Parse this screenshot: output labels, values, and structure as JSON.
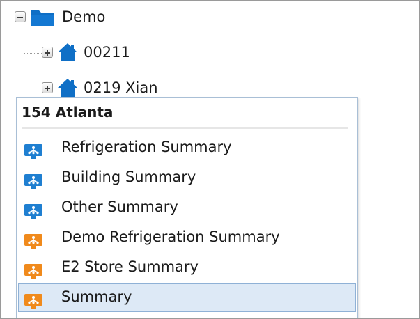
{
  "tree": {
    "root": {
      "label": "Demo",
      "icon": "folder-icon",
      "expander": "minus"
    },
    "children": [
      {
        "label": "00211",
        "icon": "house-icon",
        "expander": "plus"
      },
      {
        "label": "0219 Xian",
        "icon": "house-icon",
        "expander": "plus"
      }
    ]
  },
  "menu": {
    "title": "154 Atlanta",
    "items": [
      {
        "label": "Refrigeration Summary",
        "icon": "network-monitor-icon",
        "icon_color": "#1f7fd1",
        "selected": false
      },
      {
        "label": "Building Summary",
        "icon": "network-monitor-icon",
        "icon_color": "#1f7fd1",
        "selected": false
      },
      {
        "label": "Other Summary",
        "icon": "network-monitor-icon",
        "icon_color": "#1f7fd1",
        "selected": false
      },
      {
        "label": "Demo Refrigeration Summary",
        "icon": "network-monitor-icon",
        "icon_color": "#f08a1c",
        "selected": false
      },
      {
        "label": "E2 Store Summary",
        "icon": "network-monitor-icon",
        "icon_color": "#f08a1c",
        "selected": false
      },
      {
        "label": "Summary",
        "icon": "network-monitor-icon",
        "icon_color": "#f08a1c",
        "selected": true
      }
    ]
  },
  "colors": {
    "tree_icon_blue": "#0f6fc6",
    "menu_selected_bg": "#dde9f6",
    "menu_selected_border": "#8fb1d6",
    "menu_border": "#a9bfd6"
  }
}
